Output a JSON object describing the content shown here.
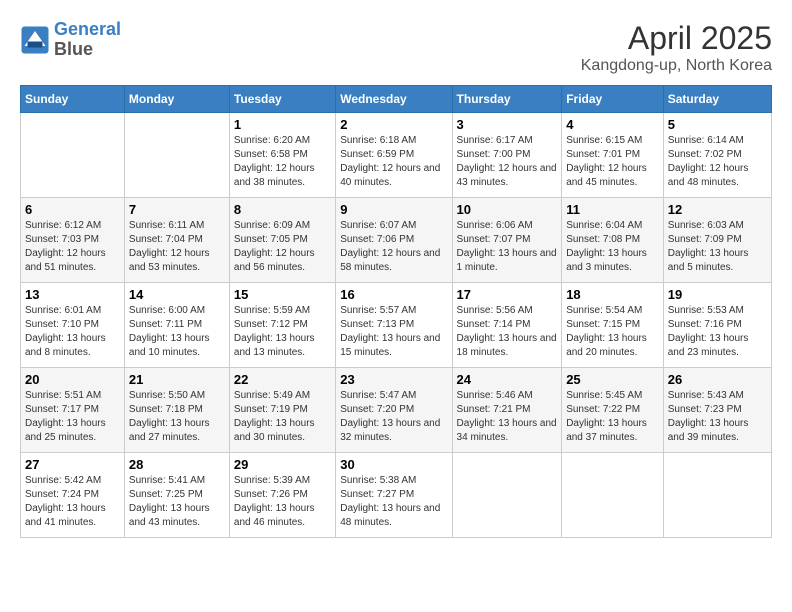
{
  "logo": {
    "line1": "General",
    "line2": "Blue"
  },
  "title": "April 2025",
  "subtitle": "Kangdong-up, North Korea",
  "weekdays": [
    "Sunday",
    "Monday",
    "Tuesday",
    "Wednesday",
    "Thursday",
    "Friday",
    "Saturday"
  ],
  "weeks": [
    [
      {
        "day": "",
        "sunrise": "",
        "sunset": "",
        "daylight": ""
      },
      {
        "day": "",
        "sunrise": "",
        "sunset": "",
        "daylight": ""
      },
      {
        "day": "1",
        "sunrise": "Sunrise: 6:20 AM",
        "sunset": "Sunset: 6:58 PM",
        "daylight": "Daylight: 12 hours and 38 minutes."
      },
      {
        "day": "2",
        "sunrise": "Sunrise: 6:18 AM",
        "sunset": "Sunset: 6:59 PM",
        "daylight": "Daylight: 12 hours and 40 minutes."
      },
      {
        "day": "3",
        "sunrise": "Sunrise: 6:17 AM",
        "sunset": "Sunset: 7:00 PM",
        "daylight": "Daylight: 12 hours and 43 minutes."
      },
      {
        "day": "4",
        "sunrise": "Sunrise: 6:15 AM",
        "sunset": "Sunset: 7:01 PM",
        "daylight": "Daylight: 12 hours and 45 minutes."
      },
      {
        "day": "5",
        "sunrise": "Sunrise: 6:14 AM",
        "sunset": "Sunset: 7:02 PM",
        "daylight": "Daylight: 12 hours and 48 minutes."
      }
    ],
    [
      {
        "day": "6",
        "sunrise": "Sunrise: 6:12 AM",
        "sunset": "Sunset: 7:03 PM",
        "daylight": "Daylight: 12 hours and 51 minutes."
      },
      {
        "day": "7",
        "sunrise": "Sunrise: 6:11 AM",
        "sunset": "Sunset: 7:04 PM",
        "daylight": "Daylight: 12 hours and 53 minutes."
      },
      {
        "day": "8",
        "sunrise": "Sunrise: 6:09 AM",
        "sunset": "Sunset: 7:05 PM",
        "daylight": "Daylight: 12 hours and 56 minutes."
      },
      {
        "day": "9",
        "sunrise": "Sunrise: 6:07 AM",
        "sunset": "Sunset: 7:06 PM",
        "daylight": "Daylight: 12 hours and 58 minutes."
      },
      {
        "day": "10",
        "sunrise": "Sunrise: 6:06 AM",
        "sunset": "Sunset: 7:07 PM",
        "daylight": "Daylight: 13 hours and 1 minute."
      },
      {
        "day": "11",
        "sunrise": "Sunrise: 6:04 AM",
        "sunset": "Sunset: 7:08 PM",
        "daylight": "Daylight: 13 hours and 3 minutes."
      },
      {
        "day": "12",
        "sunrise": "Sunrise: 6:03 AM",
        "sunset": "Sunset: 7:09 PM",
        "daylight": "Daylight: 13 hours and 5 minutes."
      }
    ],
    [
      {
        "day": "13",
        "sunrise": "Sunrise: 6:01 AM",
        "sunset": "Sunset: 7:10 PM",
        "daylight": "Daylight: 13 hours and 8 minutes."
      },
      {
        "day": "14",
        "sunrise": "Sunrise: 6:00 AM",
        "sunset": "Sunset: 7:11 PM",
        "daylight": "Daylight: 13 hours and 10 minutes."
      },
      {
        "day": "15",
        "sunrise": "Sunrise: 5:59 AM",
        "sunset": "Sunset: 7:12 PM",
        "daylight": "Daylight: 13 hours and 13 minutes."
      },
      {
        "day": "16",
        "sunrise": "Sunrise: 5:57 AM",
        "sunset": "Sunset: 7:13 PM",
        "daylight": "Daylight: 13 hours and 15 minutes."
      },
      {
        "day": "17",
        "sunrise": "Sunrise: 5:56 AM",
        "sunset": "Sunset: 7:14 PM",
        "daylight": "Daylight: 13 hours and 18 minutes."
      },
      {
        "day": "18",
        "sunrise": "Sunrise: 5:54 AM",
        "sunset": "Sunset: 7:15 PM",
        "daylight": "Daylight: 13 hours and 20 minutes."
      },
      {
        "day": "19",
        "sunrise": "Sunrise: 5:53 AM",
        "sunset": "Sunset: 7:16 PM",
        "daylight": "Daylight: 13 hours and 23 minutes."
      }
    ],
    [
      {
        "day": "20",
        "sunrise": "Sunrise: 5:51 AM",
        "sunset": "Sunset: 7:17 PM",
        "daylight": "Daylight: 13 hours and 25 minutes."
      },
      {
        "day": "21",
        "sunrise": "Sunrise: 5:50 AM",
        "sunset": "Sunset: 7:18 PM",
        "daylight": "Daylight: 13 hours and 27 minutes."
      },
      {
        "day": "22",
        "sunrise": "Sunrise: 5:49 AM",
        "sunset": "Sunset: 7:19 PM",
        "daylight": "Daylight: 13 hours and 30 minutes."
      },
      {
        "day": "23",
        "sunrise": "Sunrise: 5:47 AM",
        "sunset": "Sunset: 7:20 PM",
        "daylight": "Daylight: 13 hours and 32 minutes."
      },
      {
        "day": "24",
        "sunrise": "Sunrise: 5:46 AM",
        "sunset": "Sunset: 7:21 PM",
        "daylight": "Daylight: 13 hours and 34 minutes."
      },
      {
        "day": "25",
        "sunrise": "Sunrise: 5:45 AM",
        "sunset": "Sunset: 7:22 PM",
        "daylight": "Daylight: 13 hours and 37 minutes."
      },
      {
        "day": "26",
        "sunrise": "Sunrise: 5:43 AM",
        "sunset": "Sunset: 7:23 PM",
        "daylight": "Daylight: 13 hours and 39 minutes."
      }
    ],
    [
      {
        "day": "27",
        "sunrise": "Sunrise: 5:42 AM",
        "sunset": "Sunset: 7:24 PM",
        "daylight": "Daylight: 13 hours and 41 minutes."
      },
      {
        "day": "28",
        "sunrise": "Sunrise: 5:41 AM",
        "sunset": "Sunset: 7:25 PM",
        "daylight": "Daylight: 13 hours and 43 minutes."
      },
      {
        "day": "29",
        "sunrise": "Sunrise: 5:39 AM",
        "sunset": "Sunset: 7:26 PM",
        "daylight": "Daylight: 13 hours and 46 minutes."
      },
      {
        "day": "30",
        "sunrise": "Sunrise: 5:38 AM",
        "sunset": "Sunset: 7:27 PM",
        "daylight": "Daylight: 13 hours and 48 minutes."
      },
      {
        "day": "",
        "sunrise": "",
        "sunset": "",
        "daylight": ""
      },
      {
        "day": "",
        "sunrise": "",
        "sunset": "",
        "daylight": ""
      },
      {
        "day": "",
        "sunrise": "",
        "sunset": "",
        "daylight": ""
      }
    ]
  ]
}
